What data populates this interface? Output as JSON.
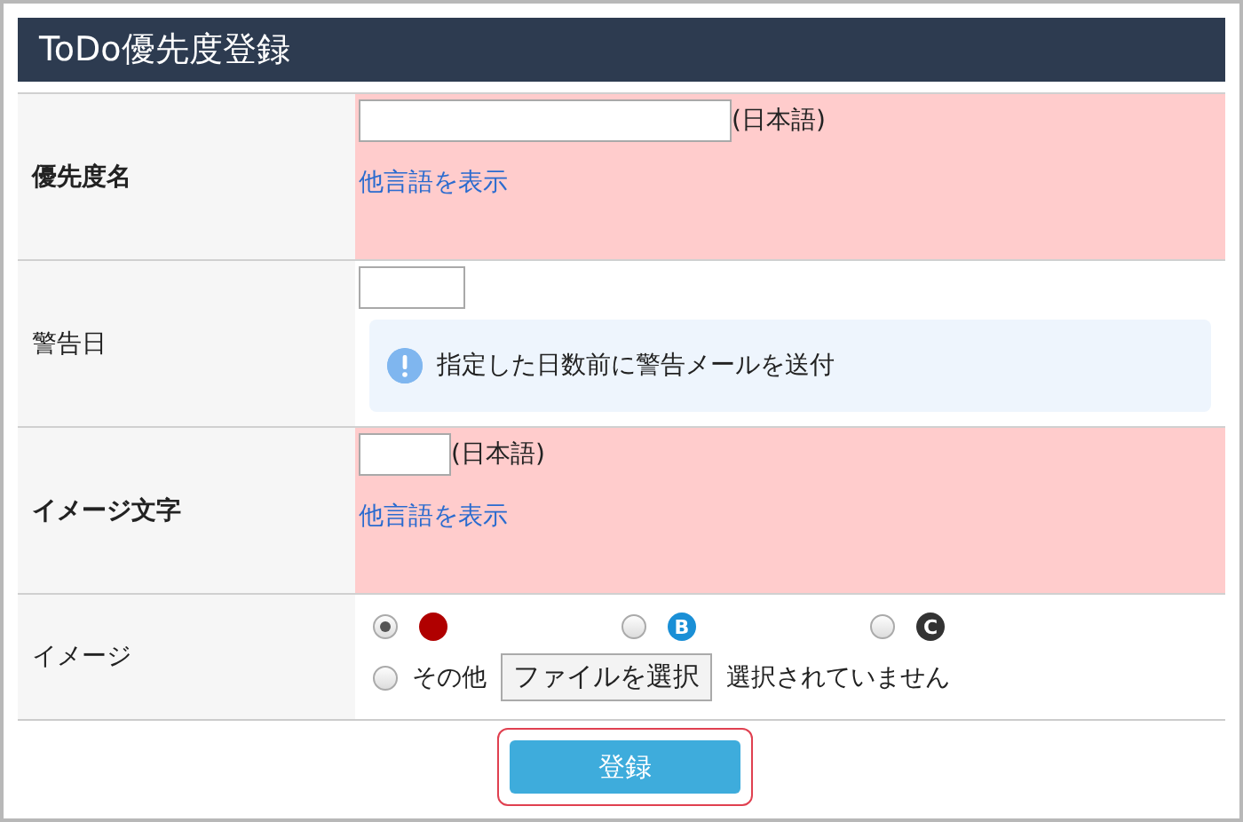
{
  "title": "ToDo優先度登録",
  "rows": [
    {
      "kind": "multilang",
      "label": "優先度名",
      "required": true,
      "wide_input": true,
      "suffix": "(日本語)",
      "link": "他言語を表示"
    },
    {
      "kind": "days",
      "label": "警告日",
      "required": false,
      "info": "指定した日数前に警告メールを送付"
    },
    {
      "kind": "multilang",
      "label": "イメージ文字",
      "required": true,
      "wide_input": false,
      "suffix": "(日本語)",
      "link": "他言語を表示"
    },
    {
      "kind": "image",
      "label": "イメージ",
      "required": false,
      "options": [
        {
          "kind": "dot",
          "selected": true,
          "color": "#b00000"
        },
        {
          "kind": "letter",
          "selected": false,
          "glyph": "B",
          "color": "#1a8fd6"
        },
        {
          "kind": "letter",
          "selected": false,
          "glyph": "C",
          "color": "#333333"
        }
      ],
      "other": {
        "selected": false,
        "label": "その他",
        "button": "ファイルを選択",
        "status": "選択されていません"
      }
    }
  ],
  "submit": "登録"
}
